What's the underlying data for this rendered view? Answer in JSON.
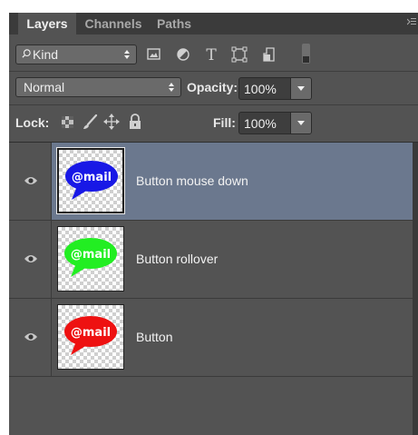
{
  "tabs": [
    {
      "label": "Layers",
      "active": true
    },
    {
      "label": "Channels",
      "active": false
    },
    {
      "label": "Paths",
      "active": false
    }
  ],
  "filter": {
    "kind_label": "Kind",
    "icons": [
      "pixel-layer-filter-icon",
      "adjustment-layer-filter-icon",
      "type-layer-filter-icon",
      "shape-layer-filter-icon",
      "smart-object-filter-icon"
    ]
  },
  "blend": {
    "mode": "Normal",
    "opacity_label": "Opacity:",
    "opacity_value": "100%"
  },
  "lock": {
    "label": "Lock:",
    "icons": [
      "lock-transparent-pixels-icon",
      "lock-image-pixels-icon",
      "lock-position-icon",
      "lock-all-icon"
    ],
    "fill_label": "Fill:",
    "fill_value": "100%"
  },
  "layers": [
    {
      "name": "Button mouse down",
      "thumb_text": "@mail",
      "thumb_color": "#1818e6",
      "selected": true,
      "visible": true
    },
    {
      "name": "Button rollover",
      "thumb_text": "@mail",
      "thumb_color": "#22ee22",
      "selected": false,
      "visible": true
    },
    {
      "name": "Button",
      "thumb_text": "@mail",
      "thumb_color": "#ee1111",
      "selected": false,
      "visible": true
    }
  ],
  "colors": {
    "panel_bg": "#535353",
    "selected_row": "#6b788e",
    "tab_bar": "#3b3b3b"
  }
}
